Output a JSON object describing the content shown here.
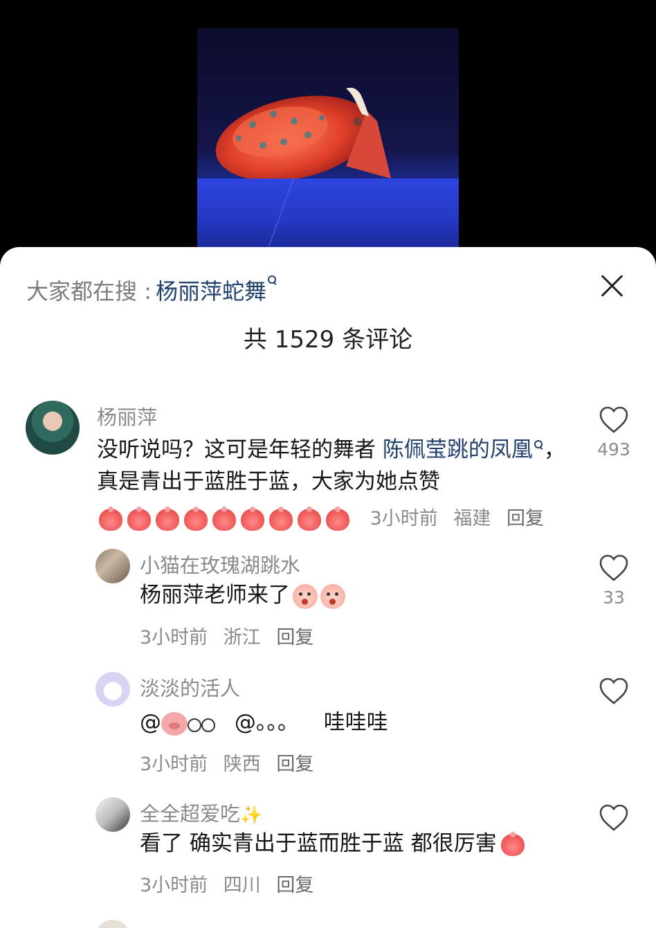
{
  "search": {
    "prefix": "大家都在搜 :",
    "term": "杨丽萍蛇舞"
  },
  "header": {
    "comment_count": "共 1529 条评论"
  },
  "comments": [
    {
      "username": "杨丽萍",
      "text_plain": "没听说吗？这可是年轻的舞者 ",
      "text_link": "陈佩莹跳的凤凰",
      "text_rest": "，真是青出于蓝胜于蓝，大家为她点赞",
      "emoji": "peach x9",
      "time": "3小时前",
      "location": "福建",
      "reply": "回复",
      "likes": "493"
    },
    {
      "username": "小猫在玫瑰湖跳水",
      "text": "杨丽萍老师来了",
      "emoji": "face x2",
      "time": "3小时前",
      "location": "浙江",
      "reply": "回复",
      "likes": "33"
    },
    {
      "username": "淡淡的活人",
      "text_at1": "@",
      "text_at2": "@。。。",
      "text_end": "哇哇哇",
      "time": "3小时前",
      "location": "陕西",
      "reply": "回复",
      "likes": ""
    },
    {
      "username": "全全超爱吃",
      "text": "看了 确实青出于蓝而胜于蓝 都很厉害",
      "time": "3小时前",
      "location": "四川",
      "reply": "回复",
      "likes": ""
    }
  ],
  "icons": {
    "close": "close-icon",
    "heart": "heart-icon",
    "search": "search-icon"
  }
}
